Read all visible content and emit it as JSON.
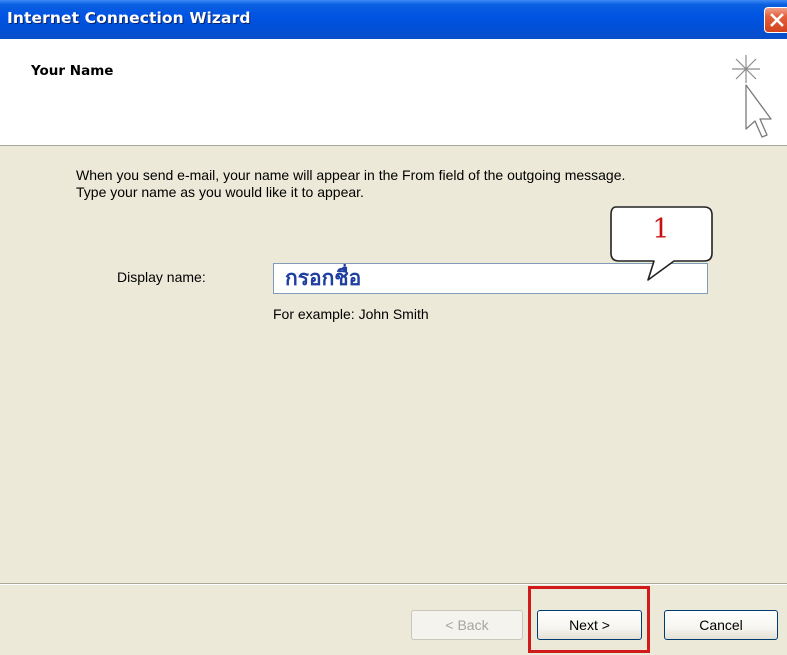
{
  "window": {
    "title": "Internet Connection Wizard"
  },
  "header": {
    "title": "Your Name",
    "icon": "wizard-cursor-icon"
  },
  "body": {
    "description_line1": "When you send e-mail, your name will appear in the From field of the outgoing message.",
    "description_line2": "Type your name as you would like it to appear.",
    "display_name_label": "Display name:",
    "display_name_value": "กรอกชื่อ",
    "example_text": "For example: John Smith"
  },
  "annotation": {
    "callout_number": "1"
  },
  "buttons": {
    "back_label": "< Back",
    "next_label": "Next >",
    "cancel_label": "Cancel"
  },
  "colors": {
    "titlebar": "#0054e3",
    "dialog_background": "#ece9d8",
    "highlight": "#d11a1a",
    "input_text": "#1f3fa0"
  }
}
